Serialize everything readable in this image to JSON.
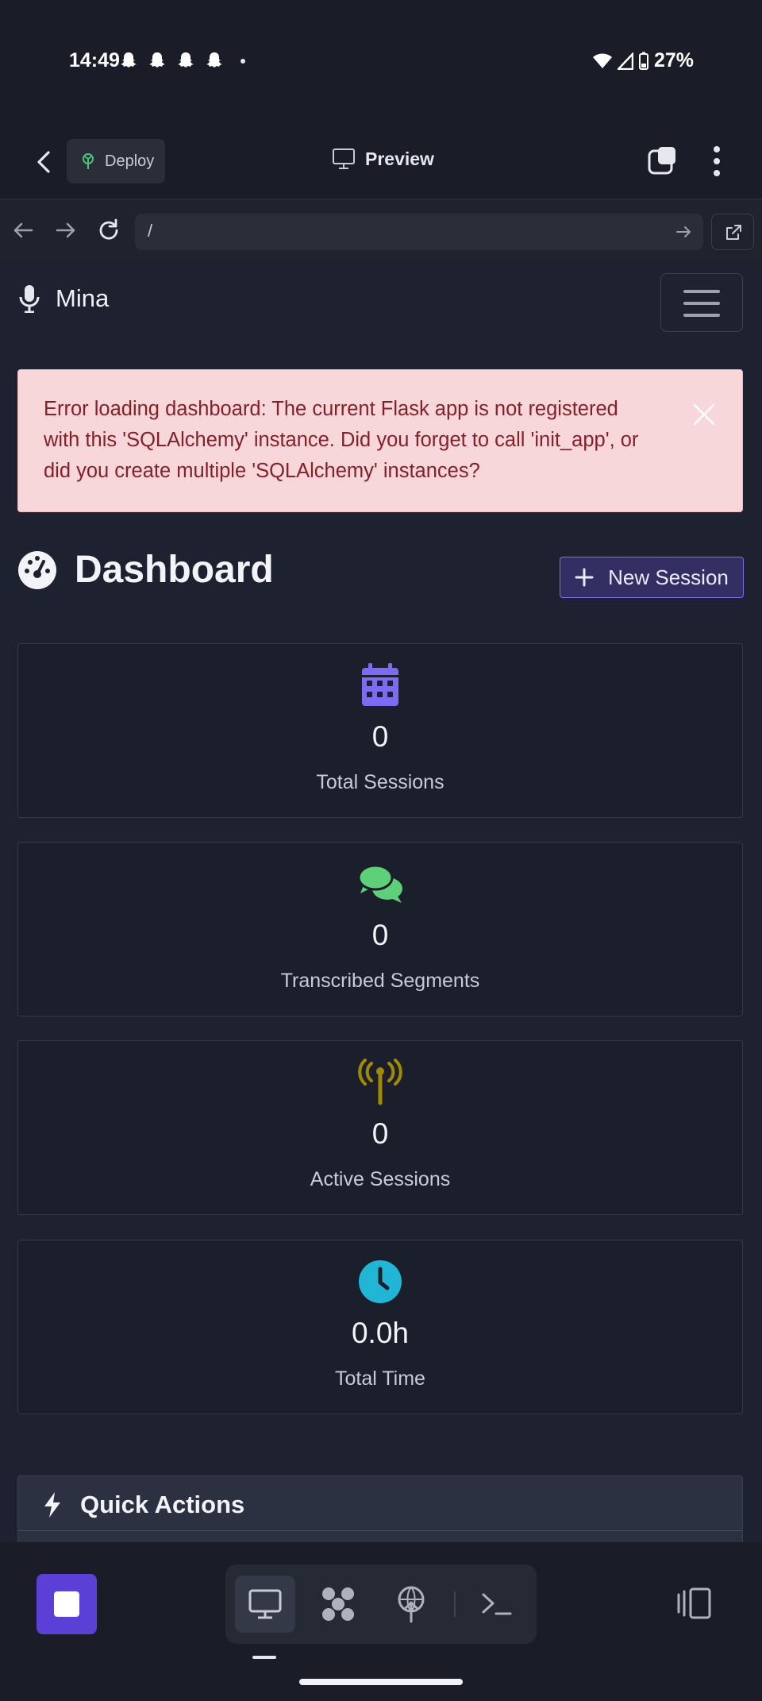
{
  "status_bar": {
    "time": "14:49",
    "battery": "27%",
    "notification_icons": [
      "snapchat-icon",
      "snapchat-icon",
      "snapchat-icon",
      "snapchat-icon"
    ]
  },
  "app_header": {
    "deploy_label": "Deploy",
    "preview_label": "Preview"
  },
  "browser": {
    "url": "/"
  },
  "navbar": {
    "brand": "Mina"
  },
  "alert": {
    "message": "Error loading dashboard: The current Flask app is not registered with this 'SQLAlchemy' instance. Did you forget to call 'init_app', or did you create multiple 'SQLAlchemy' instances?"
  },
  "dashboard": {
    "title": "Dashboard",
    "new_session_label": "New Session"
  },
  "stats": [
    {
      "icon": "calendar-icon",
      "value": "0",
      "label": "Total Sessions",
      "color": "#7b6cf6"
    },
    {
      "icon": "comments-icon",
      "value": "0",
      "label": "Transcribed Segments",
      "color": "#5fd07a"
    },
    {
      "icon": "broadcast-tower-icon",
      "value": "0",
      "label": "Active Sessions",
      "color": "#a08a00"
    },
    {
      "icon": "clock-icon",
      "value": "0.0h",
      "label": "Total Time",
      "color": "#22b6d6"
    }
  ],
  "quick_actions": {
    "title": "Quick Actions"
  },
  "colors": {
    "accent": "#5b3fd6",
    "alert_bg": "#f8d7da",
    "alert_text": "#842029"
  }
}
